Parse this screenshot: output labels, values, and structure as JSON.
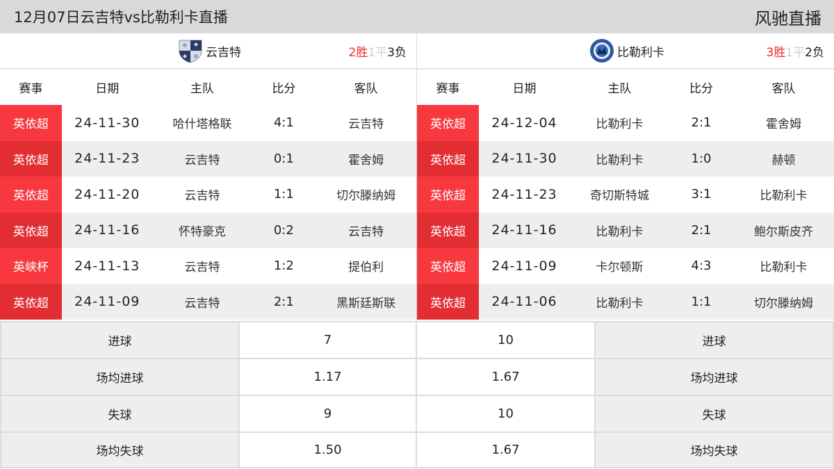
{
  "header": {
    "title": "12月07日云吉特vs比勒利卡直播",
    "brand": "风驰直播"
  },
  "columns": {
    "competition": "赛事",
    "date": "日期",
    "home": "主队",
    "score": "比分",
    "away": "客队"
  },
  "left_team": {
    "name": "云吉特",
    "logo_icon": "shield-crest-icon",
    "record": {
      "wins": "2胜",
      "draws": "1平",
      "losses": "3负"
    },
    "matches": [
      {
        "competition": "英依超",
        "date": "24-11-30",
        "home": "哈什塔格联",
        "score": "4:1",
        "away": "云吉特"
      },
      {
        "competition": "英依超",
        "date": "24-11-23",
        "home": "云吉特",
        "score": "0:1",
        "away": "霍舍姆"
      },
      {
        "competition": "英依超",
        "date": "24-11-20",
        "home": "云吉特",
        "score": "1:1",
        "away": "切尔滕纳姆"
      },
      {
        "competition": "英依超",
        "date": "24-11-16",
        "home": "怀特豪克",
        "score": "0:2",
        "away": "云吉特"
      },
      {
        "competition": "英峡杯",
        "date": "24-11-13",
        "home": "云吉特",
        "score": "1:2",
        "away": "提伯利"
      },
      {
        "competition": "英依超",
        "date": "24-11-09",
        "home": "云吉特",
        "score": "2:1",
        "away": "黑斯廷斯联"
      }
    ]
  },
  "right_team": {
    "name": "比勒利卡",
    "logo_icon": "round-crest-icon",
    "record": {
      "wins": "3胜",
      "draws": "1平",
      "losses": "2负"
    },
    "matches": [
      {
        "competition": "英依超",
        "date": "24-12-04",
        "home": "比勒利卡",
        "score": "2:1",
        "away": "霍舍姆"
      },
      {
        "competition": "英依超",
        "date": "24-11-30",
        "home": "比勒利卡",
        "score": "1:0",
        "away": "赫顿"
      },
      {
        "competition": "英依超",
        "date": "24-11-23",
        "home": "奇切斯特城",
        "score": "3:1",
        "away": "比勒利卡"
      },
      {
        "competition": "英依超",
        "date": "24-11-16",
        "home": "比勒利卡",
        "score": "2:1",
        "away": "鲍尔斯皮齐"
      },
      {
        "competition": "英依超",
        "date": "24-11-09",
        "home": "卡尔顿斯",
        "score": "4:3",
        "away": "比勒利卡"
      },
      {
        "competition": "英依超",
        "date": "24-11-06",
        "home": "比勒利卡",
        "score": "1:1",
        "away": "切尔滕纳姆"
      }
    ]
  },
  "stats": [
    {
      "label": "进球",
      "left": "7",
      "right": "10"
    },
    {
      "label": "场均进球",
      "left": "1.17",
      "right": "1.67"
    },
    {
      "label": "失球",
      "left": "9",
      "right": "10"
    },
    {
      "label": "场均失球",
      "left": "1.50",
      "right": "1.67"
    }
  ],
  "colors": {
    "win": "#f02a2a",
    "draw": "#cfcfcf",
    "badge_light": "#f7393f",
    "badge_dark": "#e22e32",
    "header_bg": "#d9d9d9"
  }
}
